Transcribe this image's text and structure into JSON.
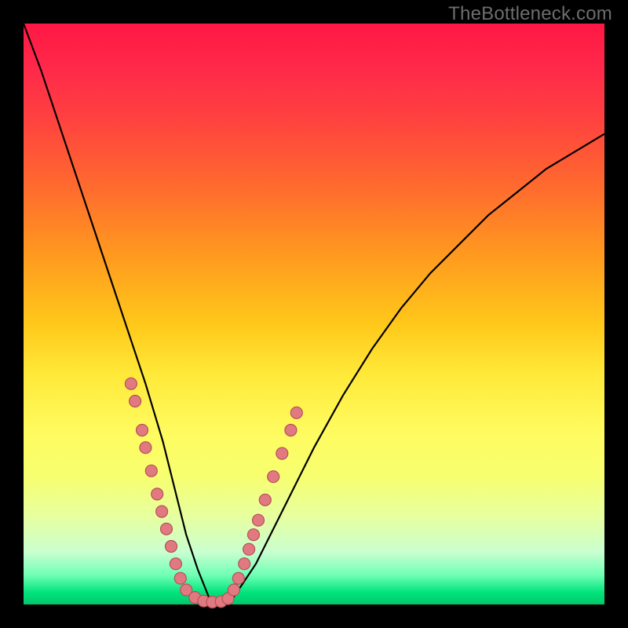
{
  "watermark": "TheBottleneck.com",
  "colors": {
    "frame": "#000000",
    "curve": "#000000",
    "marker_fill": "#e07a80",
    "marker_stroke": "#b84f58"
  },
  "chart_data": {
    "type": "line",
    "title": "",
    "xlabel": "",
    "ylabel": "",
    "xlim": [
      0,
      100
    ],
    "ylim": [
      0,
      100
    ],
    "grid": false,
    "series": [
      {
        "name": "bottleneck-curve",
        "x": [
          0,
          3,
          6,
          9,
          12,
          15,
          18,
          21,
          24,
          26,
          28,
          30,
          32,
          34,
          36,
          40,
          45,
          50,
          55,
          60,
          65,
          70,
          75,
          80,
          85,
          90,
          95,
          100
        ],
        "y": [
          100,
          92,
          83,
          74,
          65,
          56,
          47,
          38,
          28,
          20,
          12,
          6,
          1,
          0,
          1,
          7,
          17,
          27,
          36,
          44,
          51,
          57,
          62,
          67,
          71,
          75,
          78,
          81
        ]
      }
    ],
    "markers": [
      {
        "x": 18.5,
        "y": 38
      },
      {
        "x": 19.2,
        "y": 35
      },
      {
        "x": 20.4,
        "y": 30
      },
      {
        "x": 21.0,
        "y": 27
      },
      {
        "x": 22.0,
        "y": 23
      },
      {
        "x": 23.0,
        "y": 19
      },
      {
        "x": 23.8,
        "y": 16
      },
      {
        "x": 24.6,
        "y": 13
      },
      {
        "x": 25.4,
        "y": 10
      },
      {
        "x": 26.2,
        "y": 7
      },
      {
        "x": 27.0,
        "y": 4.5
      },
      {
        "x": 28.0,
        "y": 2.5
      },
      {
        "x": 29.5,
        "y": 1.2
      },
      {
        "x": 31.0,
        "y": 0.6
      },
      {
        "x": 32.5,
        "y": 0.4
      },
      {
        "x": 34.0,
        "y": 0.5
      },
      {
        "x": 35.2,
        "y": 1.0
      },
      {
        "x": 36.2,
        "y": 2.5
      },
      {
        "x": 37.0,
        "y": 4.5
      },
      {
        "x": 38.0,
        "y": 7
      },
      {
        "x": 38.8,
        "y": 9.5
      },
      {
        "x": 39.6,
        "y": 12
      },
      {
        "x": 40.4,
        "y": 14.5
      },
      {
        "x": 41.6,
        "y": 18
      },
      {
        "x": 43.0,
        "y": 22
      },
      {
        "x": 44.5,
        "y": 26
      },
      {
        "x": 46.0,
        "y": 30
      },
      {
        "x": 47.0,
        "y": 33
      }
    ]
  }
}
